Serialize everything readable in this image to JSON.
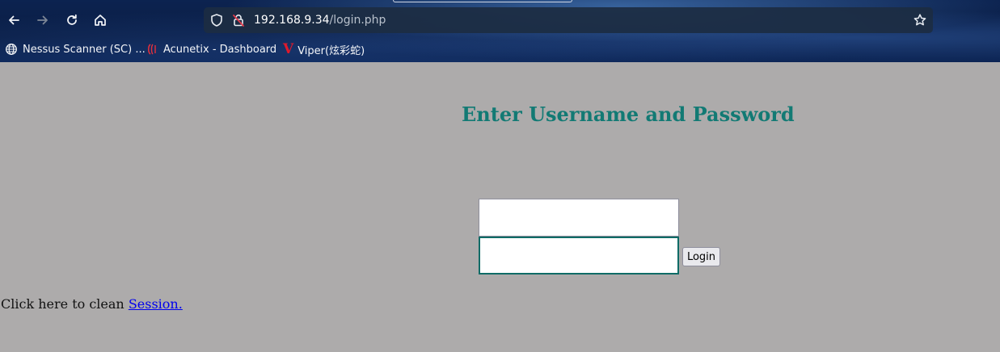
{
  "browser": {
    "url_host": "192.168.9.34",
    "url_path": "/login.php",
    "bookmarks": [
      {
        "label": "Nessus Scanner (SC) ...",
        "icon": "globe-icon"
      },
      {
        "label": "Acunetix - Dashboard",
        "icon": "acunetix-icon"
      },
      {
        "label": "Viper(炫彩蛇)",
        "icon": "viper-icon"
      }
    ]
  },
  "page": {
    "heading": "Enter Username and Password",
    "username_value": "",
    "password_value": "",
    "login_label": "Login",
    "session_text": "Click here to clean ",
    "session_link": "Session."
  },
  "colors": {
    "page_background": "#adabab",
    "heading": "#127a74",
    "focus_border": "#0f6b66",
    "link": "#0000ee"
  }
}
